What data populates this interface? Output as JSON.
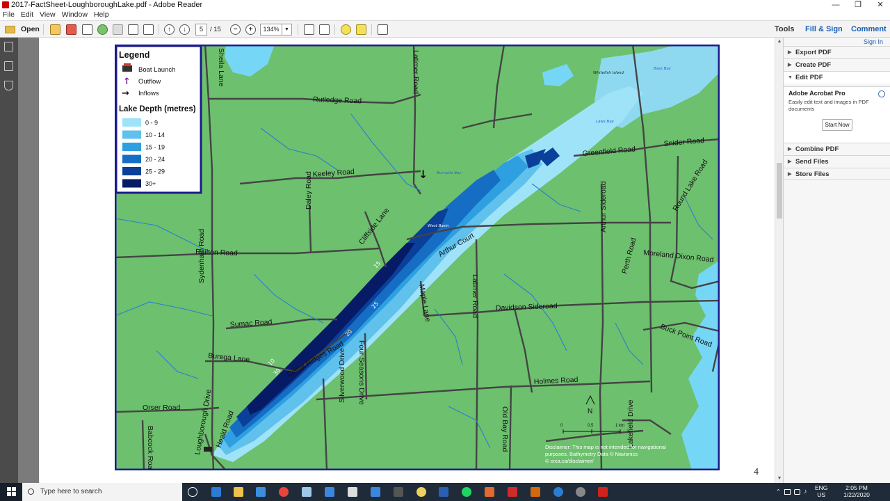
{
  "window": {
    "title": "2017-FactSheet-LoughboroughLake.pdf - Adobe Reader",
    "min": "—",
    "restore": "❐",
    "close": "✕"
  },
  "menu": [
    "File",
    "Edit",
    "View",
    "Window",
    "Help"
  ],
  "toolbar": {
    "open_label": "Open",
    "page_current": "5",
    "page_total": "/ 15",
    "zoom": "134%",
    "tools": "Tools",
    "fill_sign": "Fill & Sign",
    "comment": "Comment"
  },
  "right_pane": {
    "sign_in": "Sign In",
    "sections": [
      "Export PDF",
      "Create PDF",
      "Edit PDF",
      "Combine PDF",
      "Send Files",
      "Store Files"
    ],
    "acrobat_pro": {
      "title": "Adobe Acrobat Pro",
      "desc": "Easily edit text and images in PDF documents",
      "button": "Start Now"
    }
  },
  "document": {
    "page_number": "4"
  },
  "map": {
    "legend": {
      "title": "Legend",
      "symbols": [
        {
          "label": "Boat Launch",
          "icon": "boat-launch-icon"
        },
        {
          "label": "Outflow",
          "icon": "arrow-up-icon",
          "color": "#7a1fa0"
        },
        {
          "label": "Inflows",
          "icon": "arrow-right-icon",
          "color": "#111111"
        }
      ],
      "depth_title": "Lake Depth (metres)",
      "depth_classes": [
        {
          "label": "0 - 9",
          "color": "#9fe3f8"
        },
        {
          "label": "10 - 14",
          "color": "#5fc1ec"
        },
        {
          "label": "15 - 19",
          "color": "#2e9fe0"
        },
        {
          "label": "20 - 24",
          "color": "#156ec4"
        },
        {
          "label": "25 - 29",
          "color": "#0a3f9a"
        },
        {
          "label": "30+",
          "color": "#061a66"
        }
      ]
    },
    "roads": [
      "Sheila Lane",
      "Rutledge Road",
      "Latimer Road",
      "Keeley Road",
      "Daley Road",
      "Cliffside Lane",
      "Railton Road",
      "Arthur Court",
      "Sydenham Road",
      "Maple Lane",
      "Latimer Road",
      "Davidson Sideroad",
      "Sumac Road",
      "Burega Lane",
      "Cedar Ridges Road",
      "Silverwood Drive",
      "Four Seasons Drive",
      "Holmes Road",
      "Orser Road",
      "Babcock Road",
      "Loughborough Drive",
      "Heald Road",
      "Old Bay Road",
      "Lakefield Drive",
      "Greenfield Road",
      "Snider Road",
      "Round Lake Road",
      "Arthur Sideroad",
      "Perth Road",
      "Moreland Dixon Road",
      "Buck Point Road"
    ],
    "water_labels": [
      "Burnetts Bay",
      "West Basin",
      "Laws Bay",
      "Bass Bay",
      "Whitefish Island"
    ],
    "contours": [
      "15",
      "25",
      "20",
      "30",
      "10"
    ],
    "north": "N",
    "scale": {
      "ticks": [
        "0",
        "0.5",
        "1 km"
      ]
    },
    "disclaimer": [
      "Disclaimer: This map is not intended for navigational",
      "purposes. Bathymetry Data © Navionics",
      "© crca.ca/disclaimer/"
    ],
    "colors": {
      "land": "#6dc06e",
      "border": "#1a1a8c",
      "road": "#444444",
      "stream": "#2a7fd0",
      "lake": "#76d6f5"
    }
  },
  "taskbar": {
    "search_placeholder": "Type here to search",
    "lang_top": "ENG",
    "lang_bottom": "US",
    "time": "2:05 PM",
    "date": "1/22/2020"
  }
}
